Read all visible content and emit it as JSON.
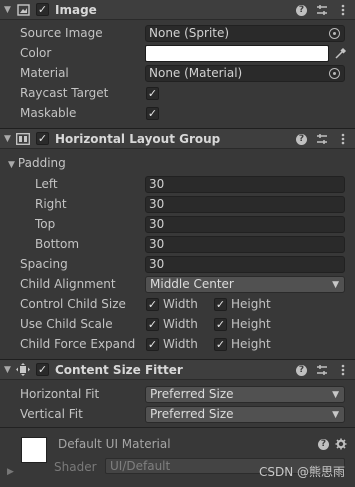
{
  "image": {
    "title": "Image",
    "source_image_label": "Source Image",
    "source_image_value": "None (Sprite)",
    "color_label": "Color",
    "color_value": "#ffffff",
    "material_label": "Material",
    "material_value": "None (Material)",
    "raycast_label": "Raycast Target",
    "raycast_checked": true,
    "maskable_label": "Maskable",
    "maskable_checked": true
  },
  "layout": {
    "title": "Horizontal Layout Group",
    "padding_label": "Padding",
    "left_label": "Left",
    "left_value": "30",
    "right_label": "Right",
    "right_value": "30",
    "top_label": "Top",
    "top_value": "30",
    "bottom_label": "Bottom",
    "bottom_value": "30",
    "spacing_label": "Spacing",
    "spacing_value": "30",
    "child_alignment_label": "Child Alignment",
    "child_alignment_value": "Middle Center",
    "control_child_size_label": "Control Child Size",
    "use_child_scale_label": "Use Child Scale",
    "child_force_expand_label": "Child Force Expand",
    "width_label": "Width",
    "height_label": "Height"
  },
  "fitter": {
    "title": "Content Size Fitter",
    "horizontal_fit_label": "Horizontal Fit",
    "horizontal_fit_value": "Preferred Size",
    "vertical_fit_label": "Vertical Fit",
    "vertical_fit_value": "Preferred Size"
  },
  "material": {
    "name": "Default UI Material",
    "shader_label": "Shader",
    "shader_value": "UI/Default"
  },
  "watermark": "CSDN @熊思雨",
  "icons": {
    "help": "?",
    "checkmark": "✓",
    "dropdown_arrow": "▼",
    "fold_open": "▼",
    "fold_closed": "▶"
  },
  "colors": {
    "panel_bg": "#383838",
    "header_bg": "#3e3e3e",
    "field_bg": "#2a2a2a",
    "dropdown_bg": "#515151"
  }
}
